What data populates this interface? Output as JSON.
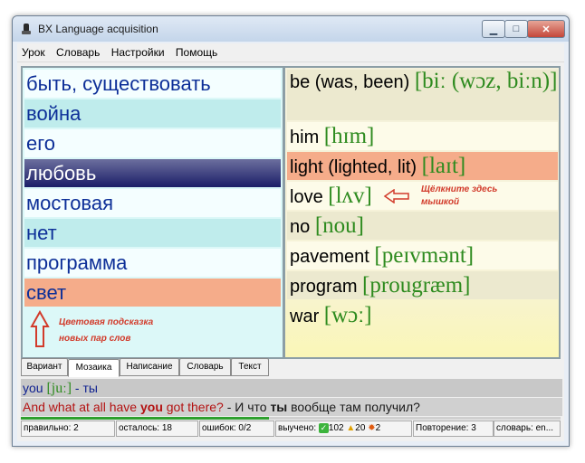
{
  "window": {
    "title": "BX Language acquisition"
  },
  "menu": [
    "Урок",
    "Словарь",
    "Настройки",
    "Помощь"
  ],
  "left_words": [
    {
      "text": "быть, существовать",
      "state": "odd"
    },
    {
      "text": "война",
      "state": "even"
    },
    {
      "text": "его",
      "state": "odd"
    },
    {
      "text": "любовь",
      "state": "selected"
    },
    {
      "text": "мостовая",
      "state": "odd"
    },
    {
      "text": "нет",
      "state": "even"
    },
    {
      "text": "программа",
      "state": "odd"
    },
    {
      "text": "свет",
      "state": "hint"
    }
  ],
  "right_words": [
    {
      "word": "be (was, been)",
      "tr": "[biː (wɔz, biːn)]"
    },
    {
      "word": "him",
      "tr": "[hɪm]"
    },
    {
      "word": "light (lighted, lit)",
      "tr": "[laɪt]"
    },
    {
      "word": "love",
      "tr": "[lʌv]"
    },
    {
      "word": "no",
      "tr": "[nou]"
    },
    {
      "word": "pavement",
      "tr": "[peɪvmənt]"
    },
    {
      "word": "program",
      "tr": "[prougræm]"
    },
    {
      "word": "war",
      "tr": "[wɔː]"
    }
  ],
  "notes": {
    "click_here_1": "Щёлкните здесь",
    "click_here_2": "мышкой",
    "hint_1": "Цветовая подсказка",
    "hint_2": "новых пар слов"
  },
  "tabs": [
    "Вариант",
    "Мозаика",
    "Написание",
    "Словарь",
    "Текст"
  ],
  "active_tab": "Мозаика",
  "current_word": {
    "word": "you",
    "tr": "[juː]",
    "dash": "-",
    "translation": "ты"
  },
  "sentence": {
    "en_1": "And what at all have ",
    "en_bold": "you",
    "en_2": " got there?",
    "sep": " - ",
    "ru_1": "И что ",
    "ru_bold": "ты",
    "ru_2": " вообще там получил?"
  },
  "progress_fraction": 0.46,
  "status": {
    "correct": "правильно: 2",
    "remaining": "осталось: 18",
    "errors": "ошибок: 0/2",
    "learned_label": "выучено:",
    "learned_ok": "102",
    "learned_warn": "20",
    "learned_bad": "2",
    "repeat": "Повторение: 3",
    "dictionary": "словарь: en..."
  },
  "colors": {
    "left_text": "#0d2f98",
    "transcription": "#2e8b1f",
    "selected_pair": "#f5ac8a",
    "annotation": "#d23b2b"
  }
}
